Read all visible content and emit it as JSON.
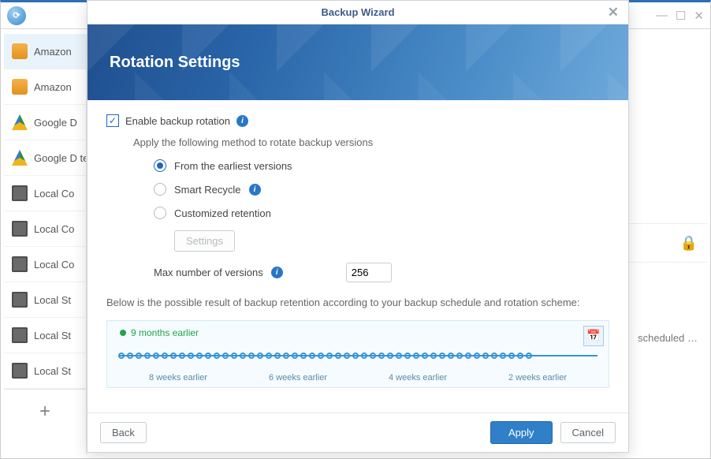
{
  "bg": {
    "win_ctrls": {
      "min": "—",
      "max": "☐",
      "close": "✕"
    },
    "lock_glyph": "🔒",
    "scheduled_text": "scheduled …"
  },
  "sidebar": {
    "items": [
      {
        "label": "Amazon",
        "icon": "amazon",
        "selected": true
      },
      {
        "label": "Amazon",
        "icon": "amazon"
      },
      {
        "label": "Google D",
        "icon": "gdrive"
      },
      {
        "label": "Google D test",
        "icon": "gdrive"
      },
      {
        "label": "Local Co",
        "icon": "local"
      },
      {
        "label": "Local Co",
        "icon": "local"
      },
      {
        "label": "Local Co",
        "icon": "local"
      },
      {
        "label": "Local St",
        "icon": "local"
      },
      {
        "label": "Local St",
        "icon": "local"
      },
      {
        "label": "Local St",
        "icon": "local"
      }
    ],
    "add_glyph": "+"
  },
  "modal": {
    "title": "Backup Wizard",
    "close_glyph": "✕",
    "banner_title": "Rotation Settings",
    "enable_label": "Enable backup rotation",
    "apply_method_label": "Apply the following method to rotate backup versions",
    "options": {
      "earliest": "From the earliest versions",
      "smart": "Smart Recycle",
      "custom": "Customized retention"
    },
    "settings_btn": "Settings",
    "max_versions_label": "Max number of versions",
    "max_versions_value": "256",
    "explain": "Below is the possible result of backup retention according to your backup schedule and rotation scheme:",
    "timeline": {
      "earliest_label": "9 months earlier",
      "markers": [
        "8 weeks earlier",
        "6 weeks earlier",
        "4 weeks earlier",
        "2 weeks earlier"
      ],
      "cal_glyph": "📅"
    },
    "footer": {
      "back": "Back",
      "apply": "Apply",
      "cancel": "Cancel"
    }
  }
}
